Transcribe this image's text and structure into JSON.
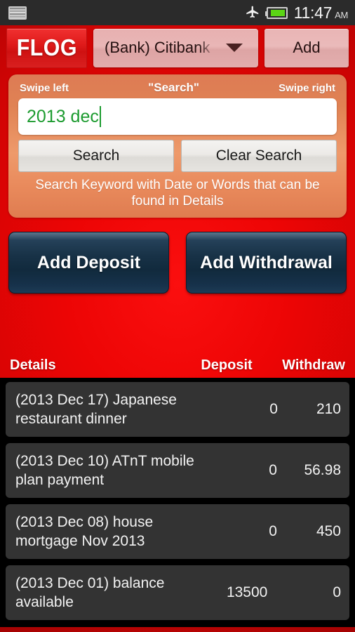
{
  "status_bar": {
    "screenshot_icon": "image-icon",
    "airplane_icon": "airplane-mode-icon",
    "battery_icon": "battery-icon",
    "time": "11:47",
    "ampm": "AM"
  },
  "app_bar": {
    "logo": "FLOG",
    "account_selected": "(Bank) Citibank S",
    "dropdown_icon": "chevron-down-icon",
    "add_label": "Add"
  },
  "search_panel": {
    "swipe_left": "Swipe left",
    "title": "\"Search\"",
    "swipe_right": "Swipe right",
    "input_value": "2013 dec",
    "input_placeholder": "",
    "search_label": "Search",
    "clear_label": "Clear Search",
    "hint": "Search Keyword with Date or Words that can be found in Details"
  },
  "actions": {
    "add_deposit": "Add Deposit",
    "add_withdrawal": "Add Withdrawal"
  },
  "list": {
    "headers": {
      "details": "Details",
      "deposit": "Deposit",
      "withdraw": "Withdraw"
    },
    "rows": [
      {
        "detail": "(2013 Dec 17) Japanese restaurant dinner",
        "deposit": "0",
        "withdraw": "210"
      },
      {
        "detail": "(2013 Dec 10) ATnT mobile plan payment",
        "deposit": "0",
        "withdraw": "56.98"
      },
      {
        "detail": "(2013 Dec 08) house mortgage Nov 2013",
        "deposit": "0",
        "withdraw": "450"
      },
      {
        "detail": "(2013 Dec 01) balance available",
        "deposit": "13500",
        "withdraw": "0"
      }
    ]
  },
  "colors": {
    "background_red": "#ed0505",
    "panel_orange": "#e98a5c",
    "navy_button": "#15304a",
    "row_background": "#333333",
    "input_text_green": "#1c9b2f"
  }
}
